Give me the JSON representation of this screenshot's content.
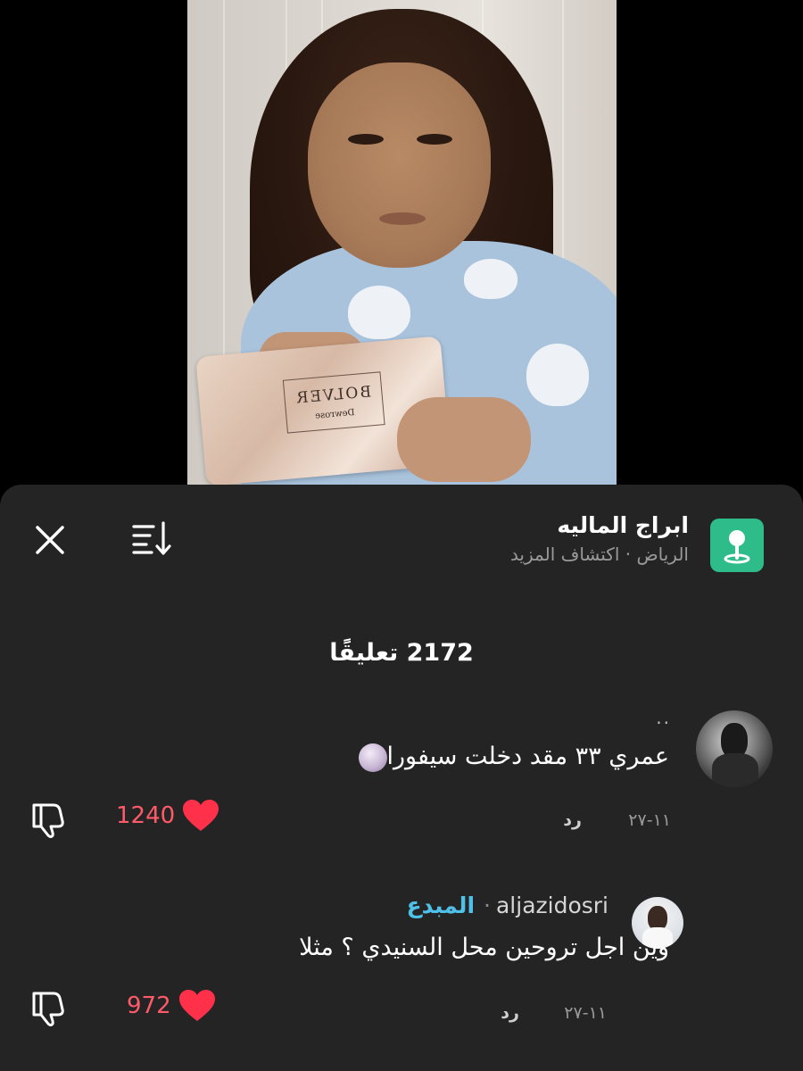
{
  "place": {
    "name": "ابراج الماليه",
    "subtitle": "الرياض · اكتشاف المزيد"
  },
  "comments_header": {
    "count_label": "2172 تعليقًا"
  },
  "comments": [
    {
      "username": "..",
      "text": "عمري ٣٣ مقد دخلت سيفورا",
      "date": "١١-٢٧",
      "reply_label": "رد",
      "likes": "1240"
    },
    {
      "username": "aljazidosri",
      "badge": "المبدع",
      "text": "وين اجل تروحين محل السنيدي ؟ مثلا",
      "date": "١١-٢٧",
      "reply_label": "رد",
      "likes": "972"
    }
  ],
  "video": {
    "card_brand": "BOLVER",
    "card_sub": "Dewrose"
  },
  "colors": {
    "sheet_bg": "#242424",
    "like": "#ff5a6a",
    "badge": "#4fc1e9",
    "place_icon": "#2ebd8a"
  },
  "icons": [
    "close-icon",
    "sort-icon",
    "location-pin-icon",
    "heart-icon",
    "dislike-icon",
    "moon-face-emoji"
  ]
}
